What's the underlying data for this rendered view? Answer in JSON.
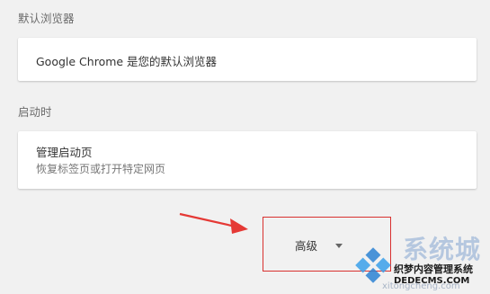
{
  "sections": {
    "default_browser": {
      "title": "默认浏览器",
      "text": "Google Chrome 是您的默认浏览器"
    },
    "on_startup": {
      "title": "启动时",
      "option_title": "管理启动页",
      "option_subtitle": "恢复标签页或打开特定网页"
    }
  },
  "advanced": {
    "label": "高级",
    "icon": "chevron-down-icon"
  },
  "annotation": {
    "arrow_color": "#e53935",
    "highlight_color": "#d8312f"
  },
  "watermark": {
    "brand": "系统城",
    "line1": "织梦内容管理系统",
    "line2": "DEDECMS.COM",
    "url": "xitongcheng.com"
  }
}
